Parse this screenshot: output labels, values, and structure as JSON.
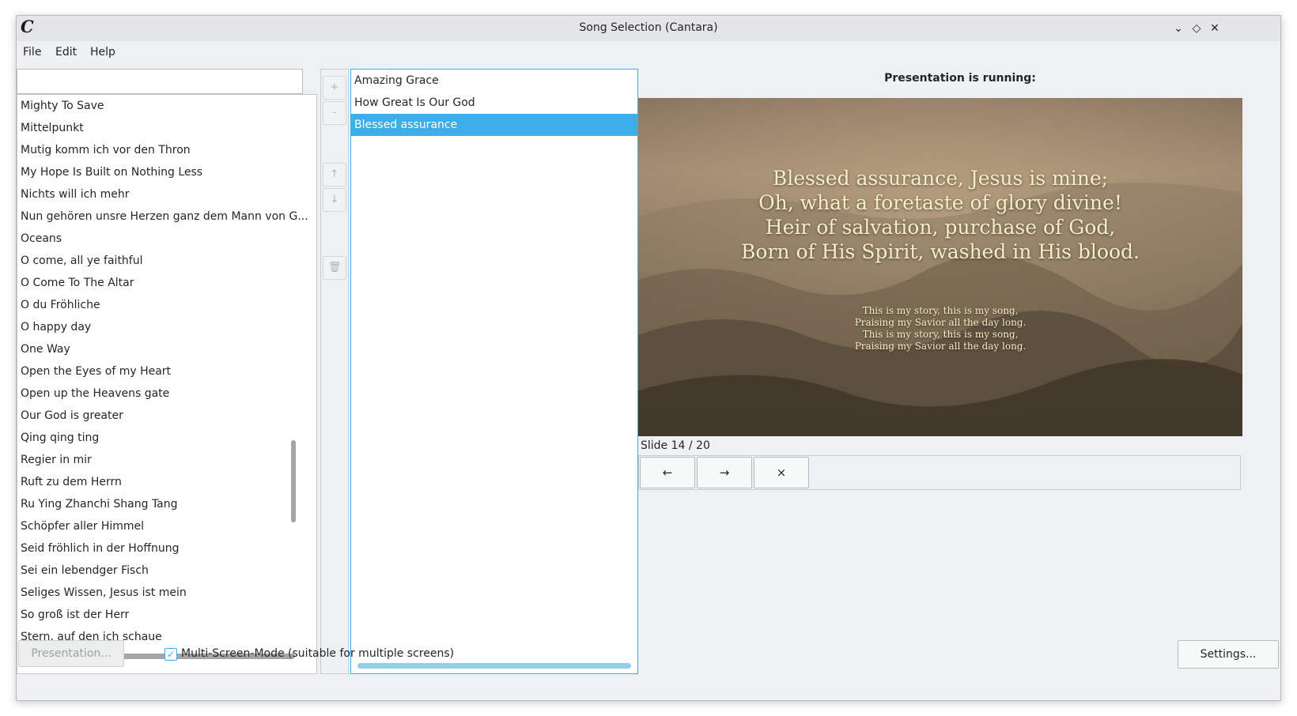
{
  "window": {
    "title": "Song Selection (Cantara)",
    "logo_letter": "C",
    "controls": {
      "minimize": "⌄",
      "maximize": "◇",
      "close": "✕"
    }
  },
  "menu": {
    "file": "File",
    "edit": "Edit",
    "help": "Help"
  },
  "search": {
    "value": "",
    "placeholder": ""
  },
  "songs": [
    "Mighty To Save",
    "Mittelpunkt",
    "Mutig komm ich vor den Thron",
    "My Hope Is Built on Nothing Less",
    "Nichts will ich mehr",
    "Nun gehören unsre Herzen ganz dem Mann von G...",
    "Oceans",
    "O come, all ye faithful",
    "O Come To The Altar",
    "O du Fröhliche",
    "O happy day",
    "One Way",
    "Open the Eyes of my Heart",
    "Open up the Heavens gate",
    "Our God is greater",
    "Qing qing ting",
    "Regier in mir",
    "Ruft zu dem Herrn",
    "Ru Ying Zhanchi Shang Tang",
    "Schöpfer aller Himmel",
    "Seid fröhlich in der Hoffnung",
    "Sei ein lebendger Fisch",
    "Seliges Wissen, Jesus ist mein",
    "So groß ist der Herr",
    "Stern, auf den ich schaue"
  ],
  "list_buttons": {
    "add": "+",
    "remove": "-",
    "up": "↑",
    "down": "↓",
    "delete": "🗑"
  },
  "playlist": {
    "items": [
      "Amazing Grace",
      "How Great Is Our God",
      "Blessed assurance"
    ],
    "selected": "Blessed assurance"
  },
  "presentation": {
    "status_label": "Presentation is running:",
    "verse_lines": [
      "Blessed assurance, Jesus is mine;",
      "Oh, what a foretaste of glory divine!",
      "Heir of salvation, purchase of God,",
      "Born of His Spirit, washed in His blood."
    ],
    "chorus_lines": [
      "This is my story, this is my song,",
      "Praising my Savior all the day long.",
      "This is my story, this is my song,",
      "Praising my Savior all the day long."
    ],
    "slide_counter": "Slide 14 / 20",
    "nav": {
      "prev": "←",
      "next": "→",
      "close": "×"
    }
  },
  "footer": {
    "presentation_button": "Presentation...",
    "multiscreen_label": "Multi-Screen-Mode (suitable for multiple screens)",
    "multiscreen_checked": true,
    "checkmark": "✓",
    "settings_button": "Settings..."
  },
  "colors": {
    "accent": "#3daee9",
    "window_bg": "#eff0f1",
    "slide_text": "#f6eec6"
  }
}
